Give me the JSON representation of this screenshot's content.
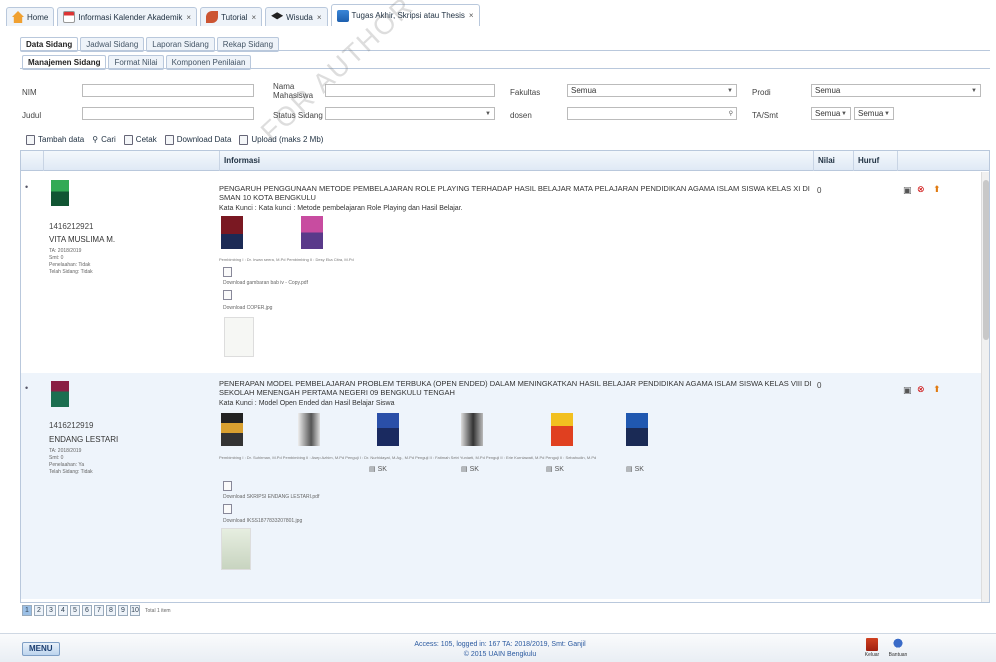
{
  "top_tabs": [
    {
      "label": "Home",
      "icon": "home-icon",
      "closable": false
    },
    {
      "label": "Informasi Kalender Akademik",
      "icon": "calendar-icon",
      "closable": true
    },
    {
      "label": "Tutorial",
      "icon": "tutorial-icon",
      "closable": true
    },
    {
      "label": "Wisuda",
      "icon": "graduation-cap-icon",
      "closable": true
    },
    {
      "label": "Tugas Akhir, Skripsi atau Thesis",
      "icon": "thesis-icon",
      "closable": true,
      "active": true
    }
  ],
  "close_glyph": "×",
  "sub_tabs": [
    "Data Sidang",
    "Jadwal Sidang",
    "Laporan Sidang",
    "Rekap Sidang"
  ],
  "sub_tabs2": [
    "Manajemen Sidang",
    "Format Nilai",
    "Komponen Penilaian"
  ],
  "filters": {
    "nim_label": "NIM",
    "nim_value": "",
    "judul_label": "Judul",
    "judul_value": "",
    "nama_label": "Nama Mahasiswa",
    "nama_value": "",
    "status_label": "Status Sidang",
    "status_value": "",
    "fakultas_label": "Fakultas",
    "fakultas_value": "Semua",
    "dosen_label": "dosen",
    "dosen_value": "",
    "prodi_label": "Prodi",
    "prodi_value": "Semua",
    "ta_label": "TA/Smt",
    "ta_value": "Semua",
    "smt_value": "Semua"
  },
  "toolbar": {
    "tambah": "Tambah data",
    "cari": "Cari",
    "cetak": "Cetak",
    "download": "Download Data",
    "upload": "Upload (maks 2 Mb)"
  },
  "grid": {
    "headers": {
      "info": "Informasi",
      "nilai": "Nilai",
      "huruf": "Huruf"
    },
    "rows": [
      {
        "nim": "1416212921",
        "name": "VITA MUSLIMA M.",
        "small_lines": [
          "TA: 2018/2019",
          "Smt: 0",
          "Penelaahan: Tidak",
          "Telah Sidang: Tidak"
        ],
        "title": "PENGARUH PENGGUNAAN METODE PEMBELAJARAN ROLE PLAYING TERHADAP HASIL BELAJAR MATA PELAJARAN PENDIDIKAN AGAMA ISLAM SISWA KELAS XI DI SMAN 10 KOTA BENGKULU",
        "keywords": "Kata Kunci : Kata kunci : Metode pembelajaran Role Playing dan Hasil Belajar.",
        "nilai": "0",
        "supervisors_caption": "Pembimbing I : Dr. Irwan seera, M.Pd   Pembimbing II : Desy Eka Citra, M.Pd",
        "downloads": [
          "Download gambaran bab iv - Copy.pdf",
          "Download COPER.jpg"
        ]
      },
      {
        "nim": "1416212919",
        "name": "ENDANG LESTARI",
        "small_lines": [
          "TA: 2018/2019",
          "Smt: 0",
          "Penelaahan: Ya",
          "Telah Sidang: Tidak"
        ],
        "title": "PENERAPAN MODEL PEMBELAJARAN PROBLEM TERBUKA (OPEN ENDED) DALAM MENINGKATKAN HASIL BELAJAR PENDIDIKAN AGAMA ISLAM SISWA KELAS VIII DI SEKOLAH MENENGAH PERTAMA NEGERI 09 BENGKULU TENGAH",
        "keywords": "Kata Kunci : Model Open Ended dan Hasil Belajar Siswa",
        "nilai": "0",
        "supervisors_caption": "Pembimbing I : Dr. Suhirman, M.Pd   Pembimbing II : Asep Azhim, M.Pd   Penguji I : Dr. Nurhidayat, M.Ag., M.Pd   Penguji II : Fatimah Setri Yuniarti, M.Pd   Penguji II : Erie Kurniawati, M.Pd   Penguji II : Sebahudin, M.Pd",
        "sk_label": "SK",
        "downloads": [
          "Download SKRIPSI ENDANG LESTARI.pdf",
          "Download IKSS1877833207801.jpg"
        ]
      }
    ]
  },
  "pager": {
    "pages": [
      "1",
      "2",
      "3",
      "4",
      "5",
      "6",
      "7",
      "8",
      "9",
      "10"
    ],
    "total": "Total 1 item"
  },
  "footer": {
    "menu": "MENU",
    "access": "Access: 105, logged in: 167 TA: 2018/2019, Smt: Ganjil",
    "copyright": "© 2015 UAIN Bengkulu",
    "keluar": "Keluar",
    "bantuan": "Bantuan"
  },
  "watermark": "FOR AUTHOR USE ONLY",
  "colors": {
    "accent": "#1d5fae",
    "row_alt": "#eef4fb",
    "header_bg": "#dfe9f5"
  }
}
